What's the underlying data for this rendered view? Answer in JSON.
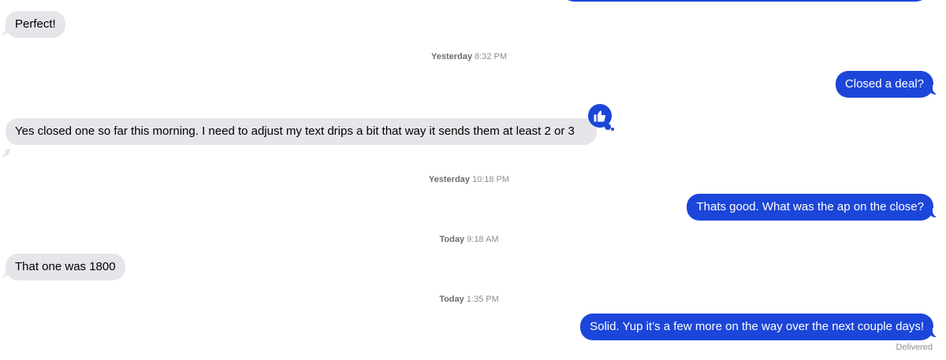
{
  "conversation": {
    "messages": [
      {
        "id": "m0",
        "direction": "outgoing",
        "text": ""
      },
      {
        "id": "m1",
        "direction": "incoming",
        "text": "Perfect!"
      },
      {
        "id": "m2",
        "direction": "outgoing",
        "text": "Closed a deal?"
      },
      {
        "id": "m3",
        "direction": "incoming",
        "text": "Yes closed one so far this morning. I need to adjust my text drips a bit that way it sends them at least 2 or 3",
        "tapback": "thumbs-up-icon"
      },
      {
        "id": "m4",
        "direction": "outgoing",
        "text": "Thats good. What was the ap on the close?"
      },
      {
        "id": "m5",
        "direction": "incoming",
        "text": "That one was 1800"
      },
      {
        "id": "m6",
        "direction": "outgoing",
        "text": "Solid. Yup it’s a few more on the way over the next couple days!"
      }
    ],
    "timestamps": [
      {
        "day": "Yesterday",
        "time": "8:32 PM"
      },
      {
        "day": "Yesterday",
        "time": "10:18 PM"
      },
      {
        "day": "Today",
        "time": "9:18 AM"
      },
      {
        "day": "Today",
        "time": "1:35 PM"
      }
    ],
    "status": "Delivered"
  },
  "colors": {
    "outgoing_bubble": "#1c46d9",
    "incoming_bubble": "#e5e5ea",
    "timestamp_text": "#8e8e93"
  }
}
